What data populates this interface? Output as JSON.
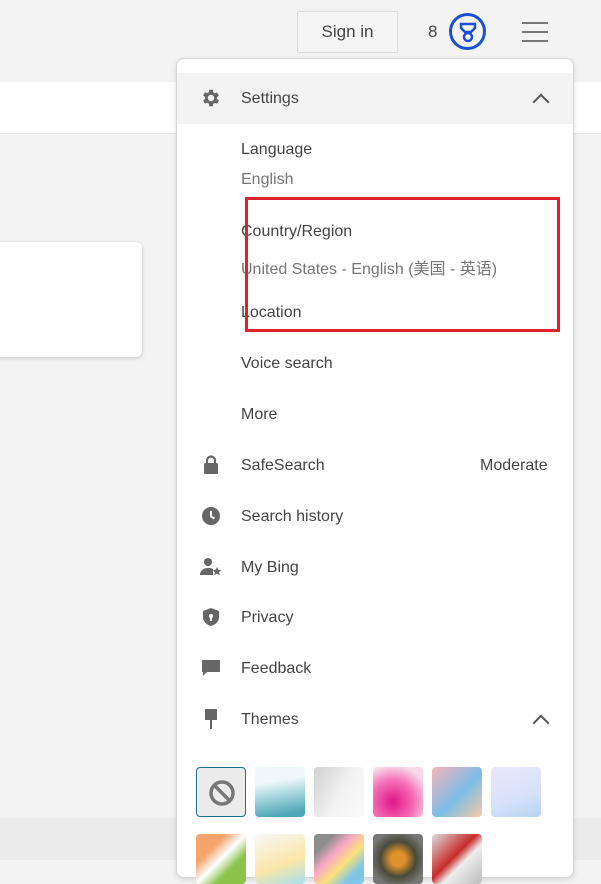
{
  "header": {
    "sign_in": "Sign in",
    "points": "8",
    "reward_icon": "trophy-icon",
    "menu_icon": "hamburger-icon"
  },
  "menu": {
    "settings": {
      "label": "Settings",
      "icon": "gear-icon"
    },
    "language": {
      "label": "Language",
      "value": "English"
    },
    "country": {
      "label": "Country/Region",
      "value": "United States - English (美国 - 英语)"
    },
    "location": "Location",
    "voice_search": "Voice search",
    "more": "More",
    "safesearch": {
      "label": "SafeSearch",
      "value": "Moderate",
      "icon": "lock-icon"
    },
    "search_history": {
      "label": "Search history",
      "icon": "clock-icon"
    },
    "my_bing": {
      "label": "My Bing",
      "icon": "person-star-icon"
    },
    "privacy": {
      "label": "Privacy",
      "icon": "shield-icon"
    },
    "feedback": {
      "label": "Feedback",
      "icon": "chat-icon"
    },
    "themes": {
      "label": "Themes",
      "icon": "paint-brush-icon",
      "tiles": [
        {
          "name": "none",
          "bg": "#ececec"
        },
        {
          "name": "waves",
          "bg": "linear-gradient(170deg,#eef8fa 30%,#a9d6df 55%,#4fa6b8 90%)"
        },
        {
          "name": "gray",
          "bg": "linear-gradient(120deg,#d0d0d0,#f3f3f3 55%,#fafafa)"
        },
        {
          "name": "bubbles",
          "bg": "radial-gradient(circle at 40% 70%,#e0168a,#f46bb5 45%,#f7d9ea 80%)"
        },
        {
          "name": "swirl",
          "bg": "linear-gradient(135deg,#f8b4b8,#7dbde6 55%,#f6c9a5)"
        },
        {
          "name": "lavender",
          "bg": "linear-gradient(160deg,#ebe8fb,#d6e2fa 60%,#b8d3f3)"
        },
        {
          "name": "arrows",
          "bg": "linear-gradient(135deg,#f6a46b 30%,#fff 50%,#8bc34a 70%)"
        },
        {
          "name": "confetti",
          "bg": "linear-gradient(160deg,#f8f8f8,#fbe6a8 60%,#a7e0f0)"
        },
        {
          "name": "pride",
          "bg": "linear-gradient(135deg,#8c8c8c 20%,#f7a8c4 40%,#f9e27a 60%,#7fc6e8 80%)"
        },
        {
          "name": "halo",
          "bg": "radial-gradient(circle at 50% 50%,#e0922a 20%,#4a4a3a 50%,#777 80%)"
        },
        {
          "name": "character",
          "bg": "linear-gradient(135deg,#ddd,#c82a2a 45%,#eee 60%,#bbb)"
        }
      ]
    }
  }
}
